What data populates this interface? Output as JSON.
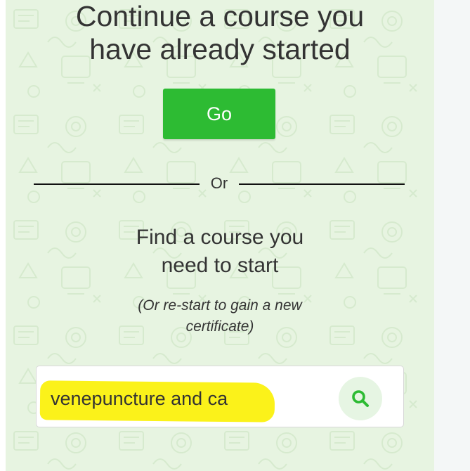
{
  "continue_section": {
    "title_line1": "Continue a course you",
    "title_line2": "have already started",
    "go_label": "Go"
  },
  "divider": {
    "or_label": "Or"
  },
  "find_section": {
    "title_line1": "Find a course you",
    "title_line2": "need to start",
    "note_line1": "(Or re-start to gain a new",
    "note_line2": "certificate)"
  },
  "search": {
    "value": "venepuncture and ca",
    "icon": "search-icon"
  },
  "colors": {
    "panel_background": "#e7f4e1",
    "go_button": "#2dbb33",
    "search_icon": "#2dbb33",
    "highlight": "#fbf21a"
  }
}
